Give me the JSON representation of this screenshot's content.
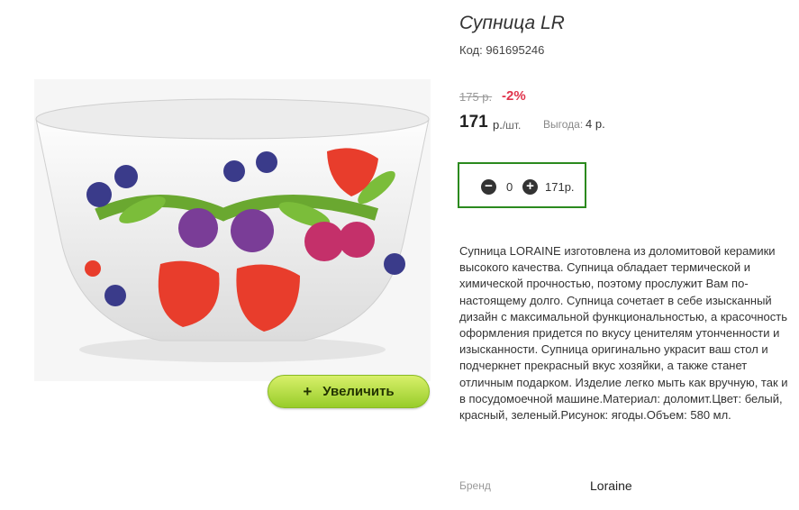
{
  "product": {
    "title": "Супница LR",
    "sku": "Код: 961695246",
    "old_price": "175 р.",
    "discount": "-2%",
    "price": "171",
    "price_currency": "р.",
    "price_unit": "/шт.",
    "savings_label": "Выгода:",
    "savings_value": "4 р.",
    "description": "Супница LORAINE изготовлена из доломитовой керамики высокого качества. Супница обладает термической и химической прочностью, поэтому прослужит Вам по-настоящему долго. Супница сочетает в себе изысканный дизайн с максимальной функциональностью, а красочность оформления придется по вкусу ценителям утонченности и изысканности. Супница оригинально украсит ваш стол и подчеркнет прекрасный вкус хозяйки, а также станет отличным подарком. Изделие легко мыть как вручную, так и в посудомоечной машине.Материал: доломит.Цвет: белый, красный, зеленый.Рисунок: ягоды.Объем: 580 мл."
  },
  "quantity": {
    "minus_icon": "minus-circle-icon",
    "plus_icon": "plus-circle-icon",
    "value": "0",
    "total": "171р."
  },
  "image": {
    "zoom_icon": "+",
    "zoom_label": "Увеличить"
  },
  "brand": {
    "label": "Бренд",
    "value": "Loraine"
  },
  "colors": {
    "accent_green": "#2b8a1e",
    "discount_red": "#e0344c",
    "zoom_button": "#b5df3a"
  }
}
